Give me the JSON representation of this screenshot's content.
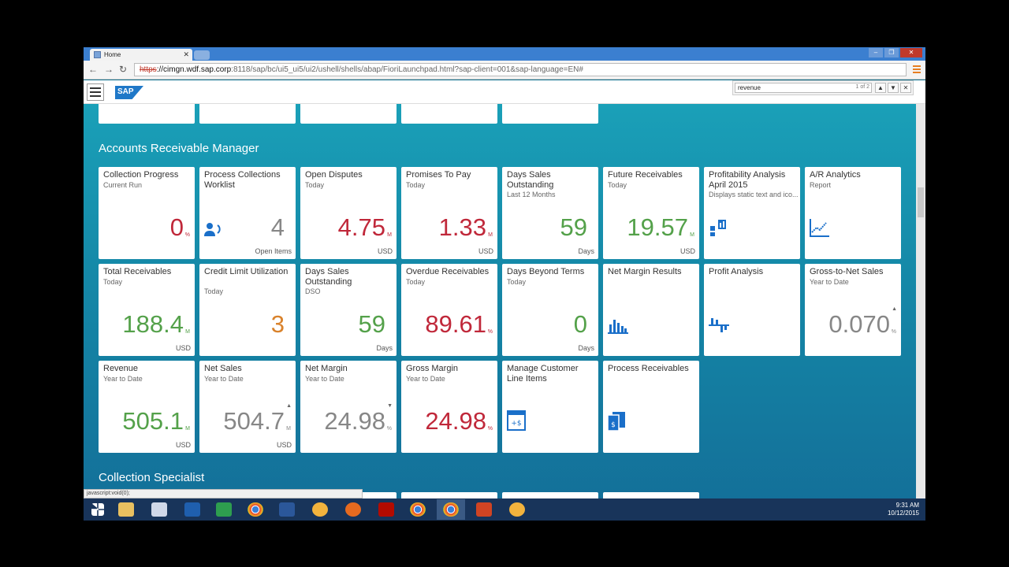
{
  "browser": {
    "tab_title": "Home",
    "url_scheme": "https",
    "url_host": "://cimgn.wdf.sap.corp",
    "url_path": ":8118/sap/bc/ui5_ui5/ui2/ushell/shells/abap/FioriLaunchpad.html?sap-client=001&sap-language=EN#",
    "find_query": "revenue",
    "find_count": "1 of 2",
    "status_tip": "javascript:void(0);"
  },
  "shell": {
    "logo": "SAP"
  },
  "groups": {
    "ar_manager": "Accounts Receivable Manager",
    "collection_specialist": "Collection Specialist"
  },
  "tiles": [
    {
      "title": "Collection Progress",
      "sub": "Current Run",
      "value": "0",
      "scale": "%",
      "unit": "",
      "color": "red"
    },
    {
      "title": "Process Collections Worklist",
      "sub": "",
      "value": "4",
      "scale": "",
      "unit": "Open Items",
      "color": "grey",
      "icon": "collections-icon"
    },
    {
      "title": "Open Disputes",
      "sub": "Today",
      "value": "4.75",
      "scale": "M",
      "unit": "USD",
      "color": "red"
    },
    {
      "title": "Promises To Pay",
      "sub": "Today",
      "value": "1.33",
      "scale": "M",
      "unit": "USD",
      "color": "red"
    },
    {
      "title": "Days Sales Outstanding",
      "sub": "Last 12 Months",
      "value": "59",
      "scale": "",
      "unit": "Days",
      "color": "green"
    },
    {
      "title": "Future Receivables",
      "sub": "Today",
      "value": "19.57",
      "scale": "M",
      "unit": "USD",
      "color": "green"
    },
    {
      "title": "Profitability Analysis April 2015",
      "sub": "Displays static text and ico...",
      "value": "",
      "scale": "",
      "unit": "",
      "color": "",
      "icon": "analysis-icon"
    },
    {
      "title": "A/R Analytics",
      "sub": "Report",
      "value": "",
      "scale": "",
      "unit": "",
      "color": "",
      "icon": "line-chart-icon"
    },
    {
      "title": "Total Receivables",
      "sub": "Today",
      "value": "188.4",
      "scale": "M",
      "unit": "USD",
      "color": "green"
    },
    {
      "title": "Credit Limit Utilization",
      "sub": "Today",
      "value": "3",
      "scale": "",
      "unit": "",
      "color": "orange"
    },
    {
      "title": "Days Sales Outstanding",
      "sub": "DSO",
      "value": "59",
      "scale": "",
      "unit": "Days",
      "color": "green"
    },
    {
      "title": "Overdue Receivables",
      "sub": "Today",
      "value": "89.61",
      "scale": "%",
      "unit": "",
      "color": "red"
    },
    {
      "title": "Days Beyond Terms",
      "sub": "Today",
      "value": "0",
      "scale": "",
      "unit": "Days",
      "color": "green"
    },
    {
      "title": "Net Margin Results",
      "sub": "",
      "value": "",
      "scale": "",
      "unit": "",
      "color": "",
      "icon": "bar-chart-icon"
    },
    {
      "title": "Profit Analysis",
      "sub": "",
      "value": "",
      "scale": "",
      "unit": "",
      "color": "",
      "icon": "variance-icon"
    },
    {
      "title": "Gross-to-Net Sales",
      "sub": "Year to Date",
      "value": "0.070",
      "scale": "%",
      "unit": "",
      "color": "grey",
      "trend": "▲"
    },
    {
      "title": "Revenue",
      "sub": "Year to Date",
      "value": "505.1",
      "scale": "M",
      "unit": "USD",
      "color": "green"
    },
    {
      "title": "Net Sales",
      "sub": "Year to Date",
      "value": "504.7",
      "scale": "M",
      "unit": "USD",
      "color": "grey",
      "trend": "▲"
    },
    {
      "title": "Net Margin",
      "sub": "Year to Date",
      "value": "24.98",
      "scale": "%",
      "unit": "",
      "color": "grey",
      "trend": "▼"
    },
    {
      "title": "Gross Margin",
      "sub": "Year to Date",
      "value": "24.98",
      "scale": "%",
      "unit": "",
      "color": "red"
    },
    {
      "title": "Manage Customer Line Items",
      "sub": "",
      "value": "",
      "scale": "",
      "unit": "",
      "color": "",
      "icon": "line-items-icon"
    },
    {
      "title": "Process Receivables",
      "sub": "",
      "value": "",
      "scale": "",
      "unit": "",
      "color": "",
      "icon": "receivables-icon"
    }
  ],
  "tray": {
    "time": "9:31 AM",
    "date": "10/12/2015"
  }
}
